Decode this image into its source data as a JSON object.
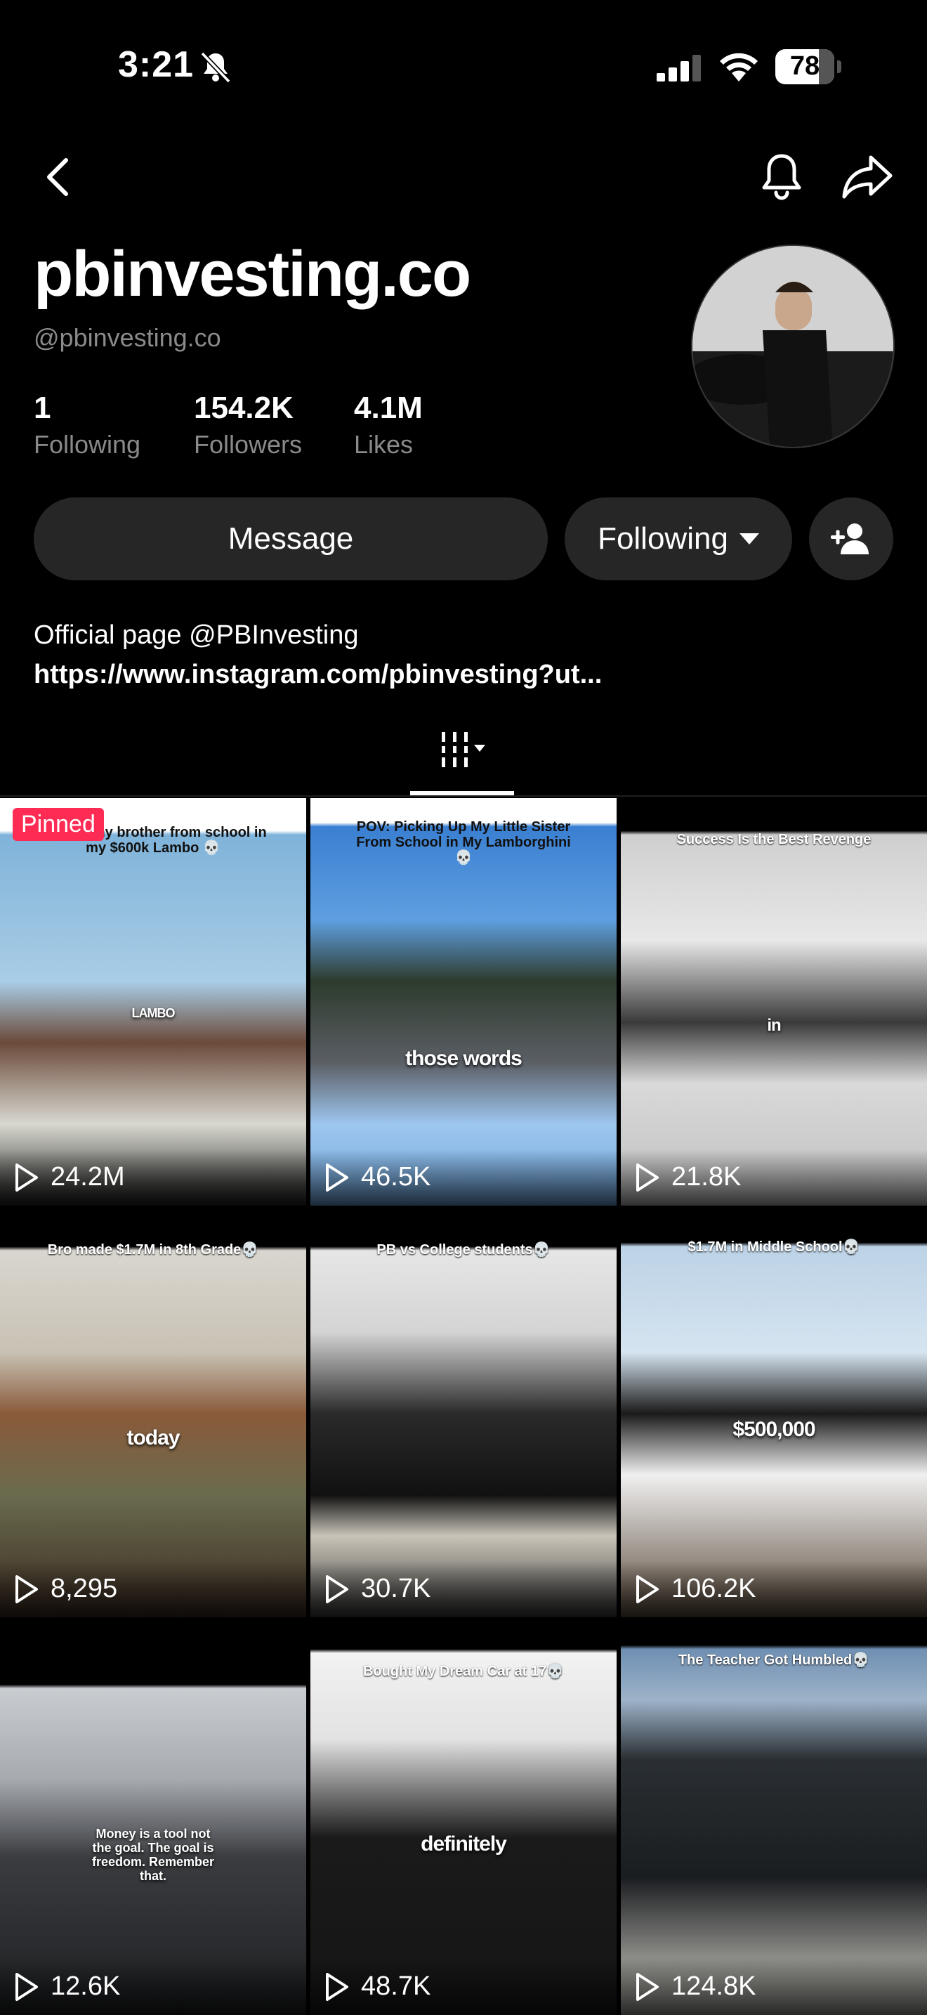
{
  "status_bar": {
    "time": "3:21",
    "battery": "78"
  },
  "profile": {
    "username": "pbinvesting.co",
    "handle": "@pbinvesting.co",
    "stats": [
      {
        "value": "1",
        "label": "Following"
      },
      {
        "value": "154.2K",
        "label": "Followers"
      },
      {
        "value": "4.1M",
        "label": "Likes"
      }
    ],
    "bio_line1_prefix": "Official page ",
    "bio_mention": "@PBInvesting",
    "bio_link": "https://www.instagram.com/pbinvesting?ut..."
  },
  "actions": {
    "message_label": "Message",
    "following_label": "Following"
  },
  "pinned_label": "Pinned",
  "videos": [
    {
      "caption": "picking my brother from school in my $600k Lambo 💀",
      "overlay": "LAMBO",
      "views": "24.2M"
    },
    {
      "caption": "POV: Picking Up My Little Sister From School in My Lamborghini💀",
      "overlay": "those words",
      "views": "46.5K"
    },
    {
      "caption": "Success Is the Best Revenge",
      "overlay": "in",
      "views": "21.8K"
    },
    {
      "caption": "Bro made $1.7M in 8th Grade💀",
      "overlay": "today",
      "views": "8,295"
    },
    {
      "caption": "PB vs College students💀",
      "overlay": "",
      "views": "30.7K"
    },
    {
      "caption": "$1.7M in Middle School💀",
      "overlay": "$500,000",
      "views": "106.2K"
    },
    {
      "caption": "",
      "overlay": "Money is a tool not the goal. The goal is freedom. Remember that.",
      "views": "12.6K"
    },
    {
      "caption": "Bought My Dream Car at 17💀",
      "overlay": "definitely",
      "views": "48.7K"
    },
    {
      "caption": "The Teacher Got Humbled💀",
      "overlay": "",
      "views": "124.8K"
    }
  ]
}
